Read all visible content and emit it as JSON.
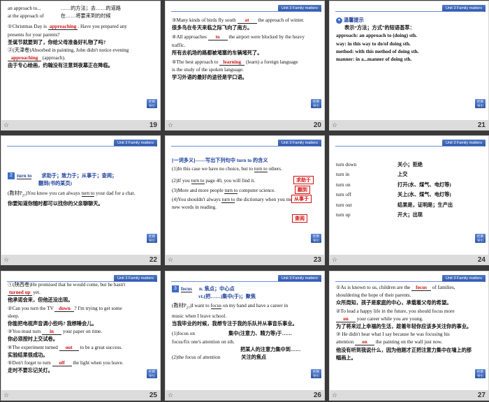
{
  "unit_tag": "Unit 3   Family matters",
  "back_label": "栏目\n导引",
  "star_icon": "star-icon",
  "slides": {
    "s19": {
      "page": "19",
      "l1a": "an approach to...",
      "l1b": "……的方法；去……的道路",
      "l2a": "at the approach of",
      "l2b": "在……将要来到的时候",
      "q1a": "①Christmas Day is ",
      "q1ans": "approaching",
      "q1b": ". Have you prepared any",
      "q1c": "presents for your parents?",
      "q1cn": "圣诞节就要到了，你给父母准备好礼物了吗?",
      "q2a": "②(天津卷)Absorbed in painting, John didn't notice evening",
      "q2ans": "approaching",
      "q2b": " (approach).",
      "q2cn": "由于专心绘画，约翰没有注意到夜幕正在降临。"
    },
    "s20": {
      "page": "20",
      "q3a": "③Many kinds of birds fly south ",
      "q3ans": "at",
      "q3b": " the approach of winter.",
      "q3cn": "很多鸟在冬天来临之际飞向了南方。",
      "q4a": "④All approaches ",
      "q4ans": "to",
      "q4b": " the airport were blocked by the heavy",
      "q4c": "traffic.",
      "q4cn": "所有去机场的路都被堵塞的车辆堵死了。",
      "q5a": "⑤The best approach to ",
      "q5ans": "learning",
      "q5b": " (learn) a foreign language",
      "q5c": "is the study of the spoken language.",
      "q5cn": "学习外语的最好的途径是学口语。"
    },
    "s21": {
      "page": "21",
      "tip": "温馨提示",
      "t1": "表示“方法；方式”的短语荟萃：",
      "t2": "approach: an approach to (doing) sth.",
      "t3": "way: in this way to do/of doing sth.",
      "t4": "method: with this method of doing sth.",
      "t5": "manner: in a...manner of doing sth."
    },
    "s22": {
      "page": "22",
      "num": "2",
      "head": "turn to",
      "meaning": "求助于；致力于；从事于；查阅；",
      "meaning2": "翻到(书的某页)",
      "ex1a": "(教材P",
      "ex1sub": "27",
      "ex1b": ")You know you can always ",
      "ex1turn": "turn to",
      "ex1c": " your dad for a chat.",
      "ex1cn": "你要知道你随时都可以找你的父亲聊聊天。"
    },
    "s23": {
      "page": "23",
      "title": "[一词多义]——写出下列句中 turn to 的含义",
      "a1": "(1)In this case we have no choice, but to ",
      "a1t": "turn to",
      "a1b": " others.",
      "ans1": "求助于",
      "a2": "(2)If you ",
      "a2t": "turn to",
      "a2b": " page 40, you will find it.",
      "ans2": "翻到",
      "a3": "(3)More and more people ",
      "a3t": "turn to",
      "a3b": " computer science.",
      "ans3": "从事于",
      "a4": "(4)You shouldn't always ",
      "a4t": "turn to",
      "a4b": " the dictionary when you meet",
      "a4c": "new words in reading.",
      "ans4": "查阅"
    },
    "s24": {
      "page": "24",
      "rows": [
        {
          "en": "turn down",
          "cn": "关小；拒绝"
        },
        {
          "en": "turn in",
          "cn": "上交"
        },
        {
          "en": "turn on",
          "cn": "打开(水、煤气、电灯等)"
        },
        {
          "en": "turn off",
          "cn": "关上(水、煤气、电灯等)"
        },
        {
          "en": "turn out",
          "cn": "结果是，证明是；生产出"
        },
        {
          "en": "turn up",
          "cn": "开大；出现"
        }
      ]
    },
    "s25": {
      "page": "25",
      "q1a": "①(陕西卷)He promised that he would come, but he hasn't",
      "q1ans": "turned up",
      "q1b": " yet.",
      "q1cn": "他承诺会来，但他还没出现。",
      "q2a": "②Can you turn the TV ",
      "q2ans": "down",
      "q2b": "? I'm trying to get some",
      "q2c": "sleep.",
      "q2cn": "你能把电视声音调小些吗? 我想睡会儿。",
      "q3a": "③You must turn ",
      "q3ans": "in",
      "q3b": " your paper on time.",
      "q3cn": "你必须按时上交试卷。",
      "q4a": "④The experiment turned ",
      "q4ans": "out",
      "q4b": " to be a great success.",
      "q4cn": "实验结果很成功。",
      "q5a": "⑤Don't forget to turn ",
      "q5ans": "off",
      "q5b": " the light when you leave.",
      "q5cn": "走时不要忘记关灯。"
    },
    "s26": {
      "page": "26",
      "num": "3",
      "head": "focus",
      "pos1": "n. 焦点；中心点",
      "pos2": "vt.(把……)集中(于)；聚焦",
      "ex1a": "(教材P",
      "ex1sub": "27",
      "ex1b": ")I want to ",
      "ex1f": "focus",
      "ex1c": " on my band and have a career in",
      "ex1d": "music when I leave school.",
      "ex1cn": "当我毕业的时候，我想专注于我的乐队并从事音乐事业。",
      "c1a": "(1)focus on",
      "c1b": "集中(注意力、精力等)于……",
      "c2a": "focus/fix one's attention on sth.",
      "c2b": "",
      "c3b": "把某人的注意力集中到……",
      "c4a": "(2)the focus of attention",
      "c4b": "关注的焦点"
    },
    "s27": {
      "page": "27",
      "q1a": "①As is known to us, children are the ",
      "q1ans": "focus",
      "q1b": " of families,",
      "q1c": "shouldering the hope of their parents.",
      "q1cn": "众所周知，孩子是家庭的中心，承载着父母的希望。",
      "q2a": "②To lead a happy life in the future, you should focus more",
      "q2ans": "on",
      "q2b": " your career while you are young.",
      "q2cn": "为了将来过上幸福的生活，趁着年轻你应该多关注你的事业。",
      "q3a": "③ He didn't hear what I say because he was focusing his",
      "q3b": "attention ",
      "q3ans": "on",
      "q3c": " the painting on the wall just now.",
      "q3cn": "他没有听到我说什么，因为他刚才正把注意力集中在墙上的那",
      "q3cn2": "幅画上。"
    }
  }
}
